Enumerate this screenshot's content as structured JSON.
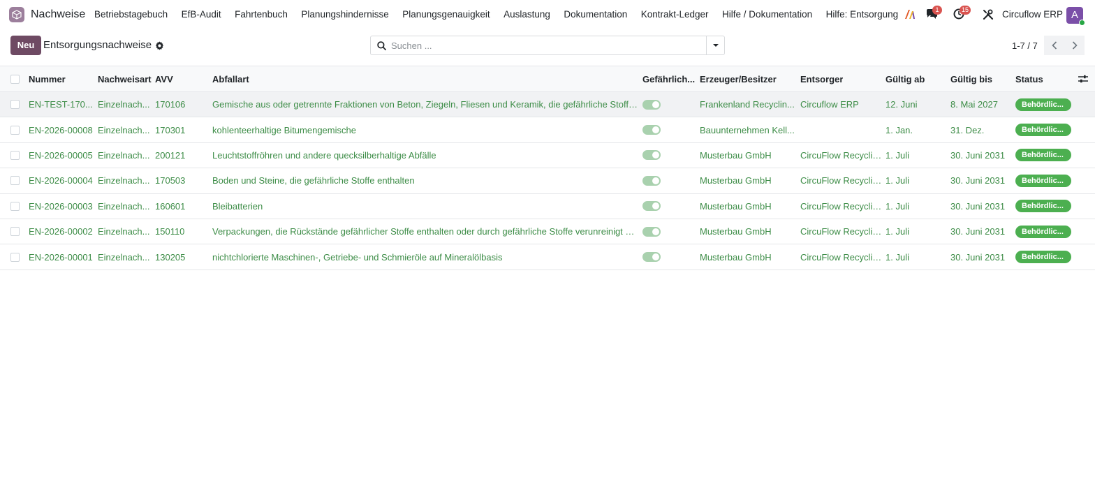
{
  "app": {
    "name": "Nachweise"
  },
  "nav": {
    "menu": [
      "Betriebstagebuch",
      "EfB-Audit",
      "Fahrtenbuch",
      "Planungshindernisse",
      "Planungsgenauigkeit",
      "Auslastung",
      "Dokumentation",
      "Kontrakt-Ledger",
      "Hilfe / Dokumentation",
      "Hilfe: Entsorgung"
    ],
    "messages_badge": "1",
    "activities_badge": "15",
    "company": "Circuflow ERP",
    "avatar_letter": "A"
  },
  "control": {
    "new_label": "Neu",
    "title": "Entsorgungsnachweise",
    "search_placeholder": "Suchen ...",
    "pager": "1-7 / 7"
  },
  "colors": {
    "brand": "#6e4a63",
    "link_green": "#3c8c46",
    "status_green": "#4caf50",
    "badge_red": "#d9534f"
  },
  "table": {
    "columns": {
      "nummer": "Nummer",
      "nachweisart": "Nachweisart",
      "avv": "AVV",
      "abfallart": "Abfallart",
      "gefaehrlich": "Gefährlich...",
      "erzeuger": "Erzeuger/Besitzer",
      "entsorger": "Entsorger",
      "gueltig_ab": "Gültig ab",
      "gueltig_bis": "Gültig bis",
      "status": "Status"
    },
    "rows": [
      {
        "nummer": "EN-TEST-170...",
        "nachweisart": "Einzelnach...",
        "avv": "170106",
        "abfallart": "Gemische aus oder getrennte Fraktionen von Beton, Ziegeln, Fliesen und Keramik, die gefährliche Stoffe e...",
        "gefaehrlich": true,
        "erzeuger": "Frankenland Recyclin...",
        "entsorger": "Circuflow ERP",
        "gueltig_ab": "12. Juni",
        "gueltig_bis": "8. Mai 2027",
        "status": "Behördlic..."
      },
      {
        "nummer": "EN-2026-00008",
        "nachweisart": "Einzelnach...",
        "avv": "170301",
        "abfallart": "kohlenteerhaltige Bitumengemische",
        "gefaehrlich": true,
        "erzeuger": "Bauunternehmen Kell...",
        "entsorger": "",
        "gueltig_ab": "1. Jan.",
        "gueltig_bis": "31. Dez.",
        "status": "Behördlic..."
      },
      {
        "nummer": "EN-2026-00005",
        "nachweisart": "Einzelnach...",
        "avv": "200121",
        "abfallart": "Leuchtstoffröhren und andere quecksilberhaltige Abfälle",
        "gefaehrlich": true,
        "erzeuger": "Musterbau GmbH",
        "entsorger": "CircuFlow Recyclin...",
        "gueltig_ab": "1. Juli",
        "gueltig_bis": "30. Juni 2031",
        "status": "Behördlic..."
      },
      {
        "nummer": "EN-2026-00004",
        "nachweisart": "Einzelnach...",
        "avv": "170503",
        "abfallart": "Boden und Steine, die gefährliche Stoffe enthalten",
        "gefaehrlich": true,
        "erzeuger": "Musterbau GmbH",
        "entsorger": "CircuFlow Recyclin...",
        "gueltig_ab": "1. Juli",
        "gueltig_bis": "30. Juni 2031",
        "status": "Behördlic..."
      },
      {
        "nummer": "EN-2026-00003",
        "nachweisart": "Einzelnach...",
        "avv": "160601",
        "abfallart": "Bleibatterien",
        "gefaehrlich": true,
        "erzeuger": "Musterbau GmbH",
        "entsorger": "CircuFlow Recyclin...",
        "gueltig_ab": "1. Juli",
        "gueltig_bis": "30. Juni 2031",
        "status": "Behördlic..."
      },
      {
        "nummer": "EN-2026-00002",
        "nachweisart": "Einzelnach...",
        "avv": "150110",
        "abfallart": "Verpackungen, die Rückstände gefährlicher Stoffe enthalten oder durch gefährliche Stoffe verunreinigt sind",
        "gefaehrlich": true,
        "erzeuger": "Musterbau GmbH",
        "entsorger": "CircuFlow Recyclin...",
        "gueltig_ab": "1. Juli",
        "gueltig_bis": "30. Juni 2031",
        "status": "Behördlic..."
      },
      {
        "nummer": "EN-2026-00001",
        "nachweisart": "Einzelnach...",
        "avv": "130205",
        "abfallart": "nichtchlorierte Maschinen-, Getriebe- und Schmieröle auf Mineralölbasis",
        "gefaehrlich": true,
        "erzeuger": "Musterbau GmbH",
        "entsorger": "CircuFlow Recyclin...",
        "gueltig_ab": "1. Juli",
        "gueltig_bis": "30. Juni 2031",
        "status": "Behördlic..."
      }
    ]
  }
}
